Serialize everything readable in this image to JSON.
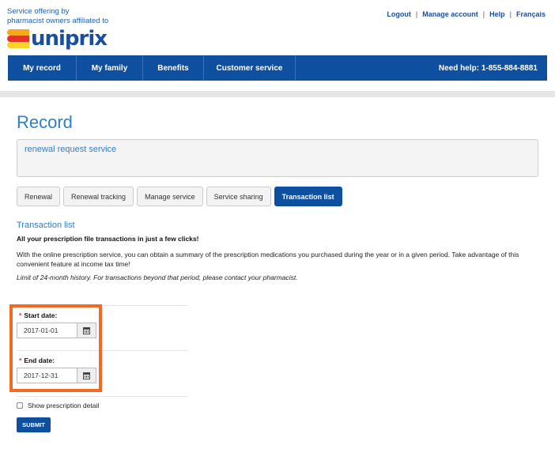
{
  "header": {
    "offering_line1": "Service offering by",
    "offering_line2": "pharmacist owners affiliated to",
    "logo_text": "uniprix",
    "links": [
      "Logout",
      "Manage account",
      "Help",
      "Français"
    ]
  },
  "nav": {
    "items": [
      "My record",
      "My family",
      "Benefits",
      "Customer service"
    ],
    "help": "Need help: 1-855-884-8881"
  },
  "main": {
    "title": "Record",
    "service_box_text": "renewal request service",
    "tabs": [
      {
        "label": "Renewal",
        "active": false
      },
      {
        "label": "Renewal tracking",
        "active": false
      },
      {
        "label": "Manage service",
        "active": false
      },
      {
        "label": "Service sharing",
        "active": false
      },
      {
        "label": "Transaction list",
        "active": true
      }
    ],
    "section_title": "Transaction list",
    "subtitle": "All your prescription file transactions in just a few clicks!",
    "description": "With the online prescription service, you can obtain a summary of the prescription medications you purchased during the year or in a given period. Take advantage of this convenient feature at income tax time!",
    "limit_note": "Limit of 24-month history. For transactions beyond that period, please contact your pharmacist."
  },
  "form": {
    "required_marker": "*",
    "start_label": "Start date:",
    "start_value": "2017-01-01",
    "end_label": "End date:",
    "end_value": "2017-12-31",
    "checkbox_label": "Show prescription detail",
    "submit_label": "SUBMIT"
  },
  "colors": {
    "brand_blue": "#0f4fa0",
    "link_blue": "#2f7fc7",
    "highlight_orange": "#f26a24",
    "required_red": "#e53935"
  },
  "icons": [
    "calendar-icon",
    "calendar-icon"
  ]
}
